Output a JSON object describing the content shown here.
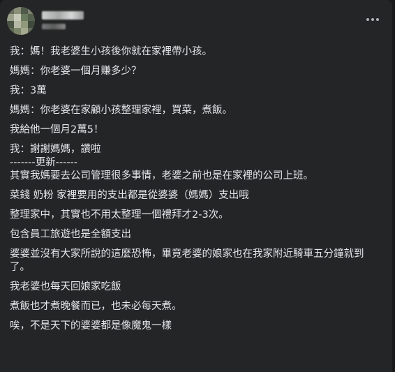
{
  "header": {
    "more_label": "..."
  },
  "post": {
    "lines": [
      "我：媽！我老婆生小孩後你就在家裡帶小孩。",
      "媽媽：你老婆一個月賺多少？",
      "我：3萬",
      "媽媽：你老婆在家顧小孩整理家裡，買菜，煮飯。",
      "我給他一個月2萬5！",
      "我：謝謝媽媽，讚啦",
      "-------更新------",
      "其實我媽要去公司管理很多事情，老婆之前也是在家裡的公司上班。",
      "菜錢 奶粉 家裡要用的支出都是從婆婆（媽媽）支出哦",
      "整理家中，其實也不用太整理一個禮拜才2-3次。",
      "包含員工旅遊也是全額支出",
      "婆婆並沒有大家所說的這麼恐怖，畢竟老婆的娘家也在我家附近騎車五分鐘就到了。",
      "我老婆也每天回娘家吃飯",
      "煮飯也才煮晚餐而已，也未必每天煮。",
      "唉，不是天下的婆婆都是像魔鬼一樣"
    ]
  }
}
